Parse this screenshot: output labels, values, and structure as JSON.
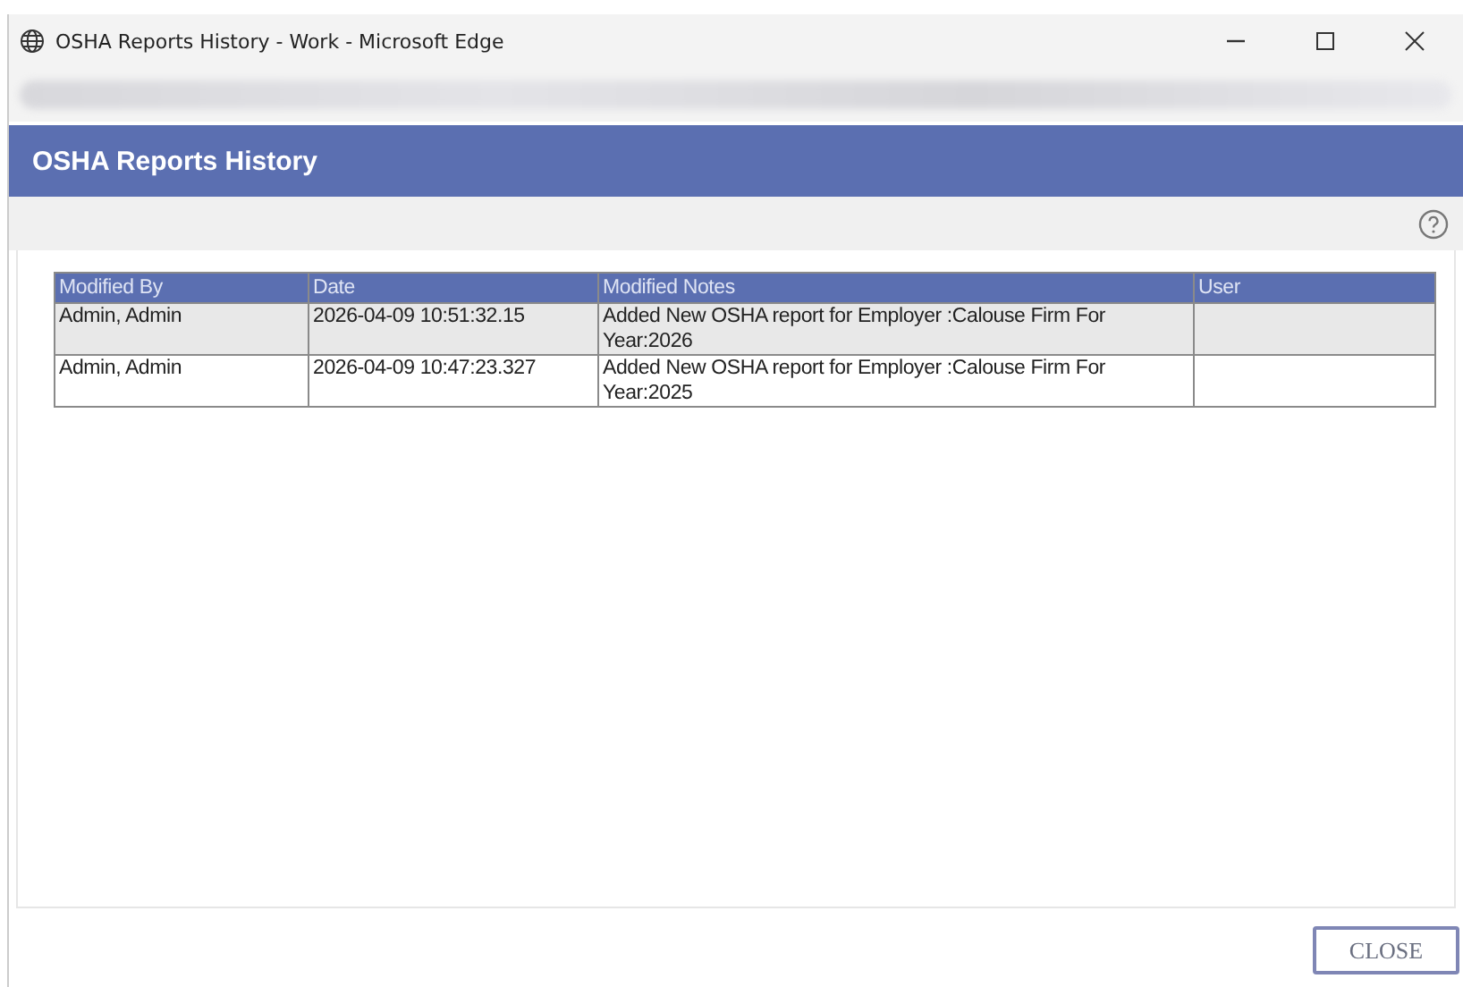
{
  "window": {
    "title": "OSHA Reports History - Work - Microsoft Edge"
  },
  "header": {
    "title": "OSHA Reports History"
  },
  "table": {
    "columns": [
      "Modified By",
      "Date",
      "Modified Notes",
      "User"
    ],
    "rows": [
      {
        "cells": [
          "Admin, Admin",
          "2026-04-09 10:51:32.15",
          "Added New OSHA report for Employer :Calouse Firm For Year:2026",
          ""
        ],
        "shaded": true
      },
      {
        "cells": [
          "Admin, Admin",
          "2026-04-09 10:47:23.327",
          "Added New OSHA report for Employer :Calouse Firm For Year:2025",
          ""
        ],
        "shaded": false
      }
    ]
  },
  "buttons": [
    {
      "label": "CLOSE"
    }
  ]
}
